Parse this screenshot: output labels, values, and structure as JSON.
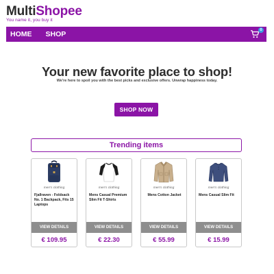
{
  "header": {
    "logo_part1": "Multi",
    "logo_part2": "Shopee",
    "tagline": "You name it, you buy it"
  },
  "navbar": {
    "links": [
      "HOME",
      "SHOP"
    ],
    "cart_count": "0",
    "color": "#8b14a6"
  },
  "hero": {
    "title": "Your new favorite place to shop!",
    "subtitle": "We're here to spoil you with the best picks and exclusive offers. Unwrap happiness today.",
    "cta": "SHOP NOW"
  },
  "trending": {
    "title": "Trending items",
    "products": [
      {
        "category": "men's clothing",
        "name": "Fjallraven - Foldsack No. 1 Backpack, Fits 15 Laptops",
        "button": "VIEW DETAILS",
        "price": "€ 109.95",
        "icon": "backpack-icon"
      },
      {
        "category": "men's clothing",
        "name": "Mens Casual Premium Slim Fit T-Shirts",
        "button": "VIEW DETAILS",
        "price": "€ 22.30",
        "icon": "tshirt-icon"
      },
      {
        "category": "men's clothing",
        "name": "Mens Cotton Jacket",
        "button": "VIEW DETAILS",
        "price": "€ 55.99",
        "icon": "jacket-icon"
      },
      {
        "category": "men's clothing",
        "name": "Mens Casual Slim Fit",
        "button": "VIEW DETAILS",
        "price": "€ 15.99",
        "icon": "sweater-icon"
      }
    ]
  }
}
